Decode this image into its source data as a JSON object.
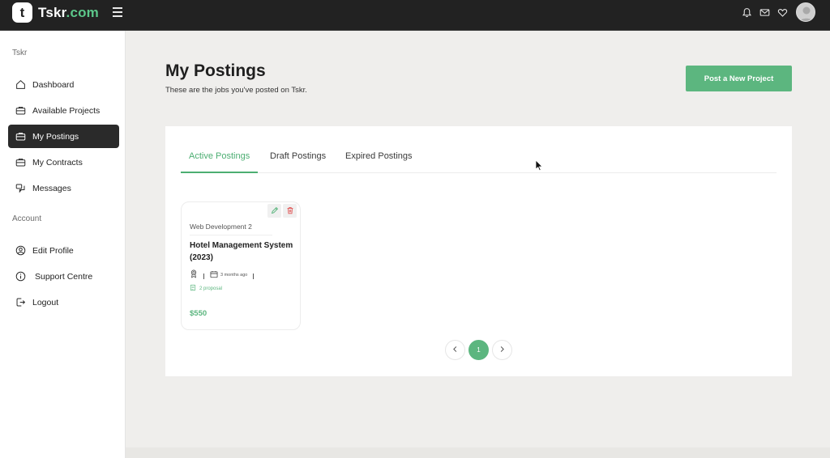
{
  "app": {
    "logo_mark": "t",
    "brand_name": "Tskr",
    "brand_suffix": ".com",
    "accent_color": "#5cb67f"
  },
  "topbar": {
    "icons": [
      "menu-icon",
      "bell-icon",
      "mail-icon",
      "heart-icon",
      "avatar"
    ]
  },
  "sidebar": {
    "section1_heading": "Tskr",
    "items": [
      {
        "label": "Dashboard",
        "icon": "home-icon"
      },
      {
        "label": "Available Projects",
        "icon": "briefcase-icon"
      },
      {
        "label": "My Postings",
        "icon": "briefcase-icon",
        "active": true
      },
      {
        "label": "My Contracts",
        "icon": "briefcase-icon"
      },
      {
        "label": "Messages",
        "icon": "chat-icon"
      }
    ],
    "section2_heading": "Account",
    "account_items": [
      {
        "label": "Edit Profile",
        "icon": "user-circle-icon"
      },
      {
        "label": "Support Centre",
        "icon": "info-icon"
      },
      {
        "label": "Logout",
        "icon": "logout-icon"
      }
    ]
  },
  "main": {
    "title": "My Postings",
    "subtitle": "These are the jobs you've posted on Tskr.",
    "post_button": "Post a New Project",
    "tabs": [
      {
        "label": "Active Postings",
        "active": true
      },
      {
        "label": "Draft Postings"
      },
      {
        "label": "Expired Postings"
      }
    ],
    "postings": [
      {
        "category": "Web Development 2",
        "title": "Hotel Management System (2023)",
        "posted": "3 months ago",
        "proposals": "2 proposal",
        "price": "$550"
      }
    ],
    "pagination": {
      "current_page": "1"
    }
  }
}
